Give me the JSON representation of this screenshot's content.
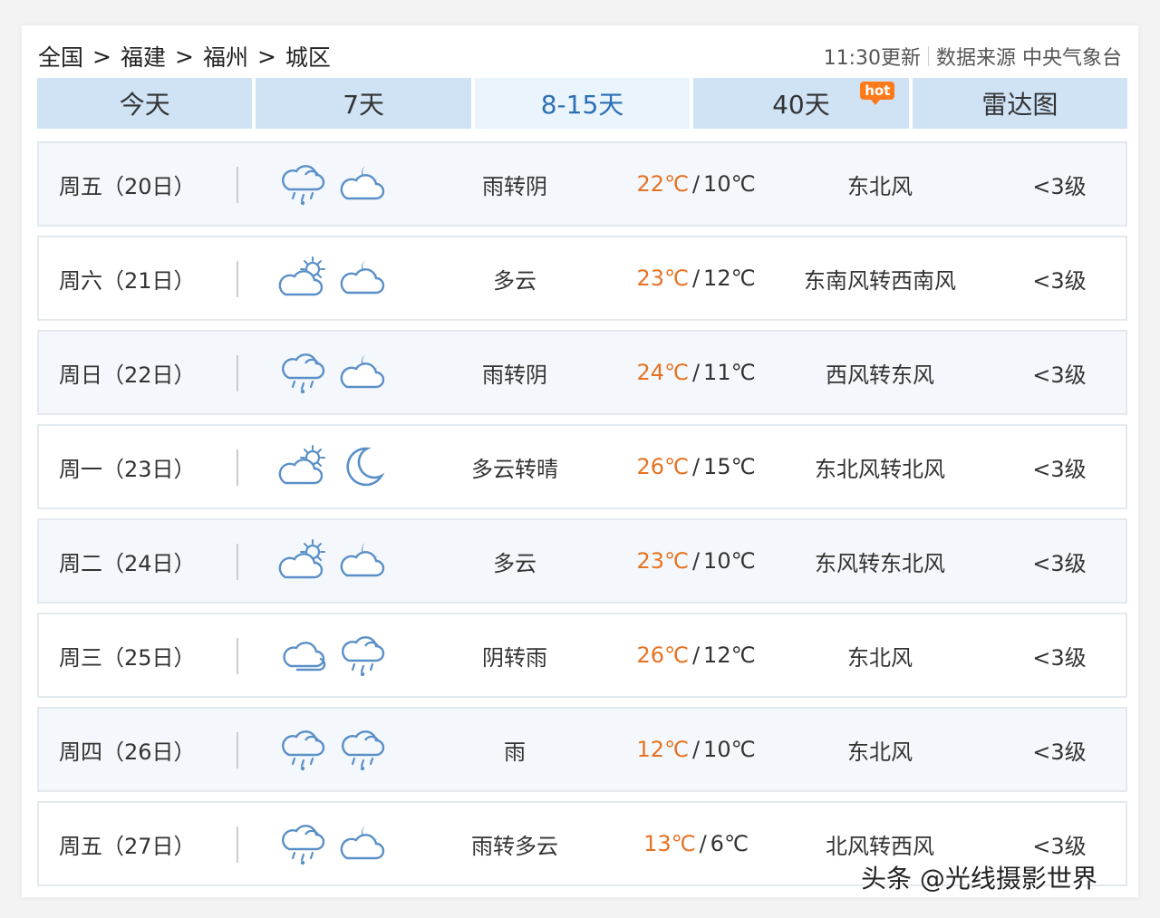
{
  "breadcrumb": [
    "全国",
    "福建",
    "福州",
    "城区"
  ],
  "breadcrumb_sep": ">",
  "source": {
    "update": "11:30更新",
    "label": "数据来源 中央气象台"
  },
  "tabs": [
    {
      "label": "今天",
      "active": false
    },
    {
      "label": "7天",
      "active": false
    },
    {
      "label": "8-15天",
      "active": true
    },
    {
      "label": "40天",
      "active": false,
      "badge": "hot"
    },
    {
      "label": "雷达图",
      "active": false
    }
  ],
  "rows": [
    {
      "date": "周五（20日）",
      "icons": [
        "cloud-rain-icon",
        "moon-cloud-icon"
      ],
      "desc": "雨转阴",
      "hi": "22℃",
      "lo": "10℃",
      "wind": "东北风",
      "level": "<3级"
    },
    {
      "date": "周六（21日）",
      "icons": [
        "sun-cloud-icon",
        "moon-cloud-icon"
      ],
      "desc": "多云",
      "hi": "23℃",
      "lo": "12℃",
      "wind": "东南风转西南风",
      "level": "<3级"
    },
    {
      "date": "周日（22日）",
      "icons": [
        "cloud-rain-icon",
        "moon-cloud-icon"
      ],
      "desc": "雨转阴",
      "hi": "24℃",
      "lo": "11℃",
      "wind": "西风转东风",
      "level": "<3级"
    },
    {
      "date": "周一（23日）",
      "icons": [
        "sun-cloud-icon",
        "moon-icon"
      ],
      "desc": "多云转晴",
      "hi": "26℃",
      "lo": "15℃",
      "wind": "东北风转北风",
      "level": "<3级"
    },
    {
      "date": "周二（24日）",
      "icons": [
        "sun-cloud-icon",
        "moon-cloud-icon"
      ],
      "desc": "多云",
      "hi": "23℃",
      "lo": "10℃",
      "wind": "东风转东北风",
      "level": "<3级"
    },
    {
      "date": "周三（25日）",
      "icons": [
        "cloud-icon",
        "cloud-rain-icon"
      ],
      "desc": "阴转雨",
      "hi": "26℃",
      "lo": "12℃",
      "wind": "东北风",
      "level": "<3级"
    },
    {
      "date": "周四（26日）",
      "icons": [
        "cloud-rain-icon",
        "cloud-rain-icon"
      ],
      "desc": "雨",
      "hi": "12℃",
      "lo": "10℃",
      "wind": "东北风",
      "level": "<3级"
    },
    {
      "date": "周五（27日）",
      "icons": [
        "cloud-rain-icon",
        "moon-cloud-icon"
      ],
      "desc": "雨转多云",
      "hi": "13℃",
      "lo": "6℃",
      "wind": "北风转西风",
      "level": "<3级"
    }
  ],
  "watermark": "头条 @光线摄影世界",
  "colors": {
    "tab_bg": "#cfe3f5",
    "tab_active_bg": "#eaf4fd",
    "tab_active_text": "#2c6fb4",
    "high_temp": "#e67322",
    "hot_badge": "#ff7a1a",
    "icon_stroke": "#5a8fc8"
  }
}
